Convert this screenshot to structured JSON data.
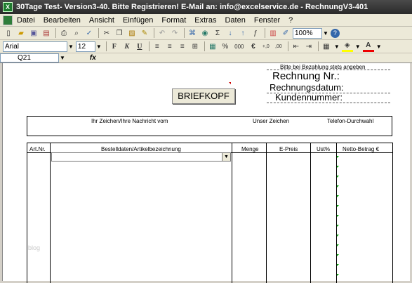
{
  "window": {
    "title": "30Tage Test- Version3-40. Bitte Registrieren! E-Mail an: info@excelservice.de - RechnungV3-401",
    "app_icon": "X"
  },
  "menu": [
    "Datei",
    "Bearbeiten",
    "Ansicht",
    "Einfügen",
    "Format",
    "Extras",
    "Daten",
    "Fenster",
    "?"
  ],
  "toolbar": {
    "zoom": "100%",
    "font": "Arial",
    "size": "12",
    "bold": "F",
    "italic": "K",
    "underline": "U",
    "percent": "%",
    "thousands": "000",
    "euro": "€",
    "inc_dec": ",0\n,00",
    "dec_dec": ",00\n,0"
  },
  "formula_bar": {
    "name_box": "Q21",
    "fx": "fx"
  },
  "sheet": {
    "payment_note": "Bitte bei Bezahlung stets angeben",
    "rechnung_nr": "Rechnung Nr.:",
    "rechnungsdatum": "Rechnungsdatum:",
    "kundennummer": "Kundennummer:",
    "briefkopf": "BRIEFKOPF",
    "info_labels": [
      "Ihr Zeichen/Ihre Nachricht vom",
      "Unser Zeichen",
      "Telefon-Durchwahl"
    ],
    "columns": [
      "Art.Nr.",
      "Bestelldaten/Artikelbezeichnung",
      "Menge",
      "E-Preis",
      "Ust%",
      "Netto-Betrag €"
    ],
    "watermark": "blog"
  }
}
